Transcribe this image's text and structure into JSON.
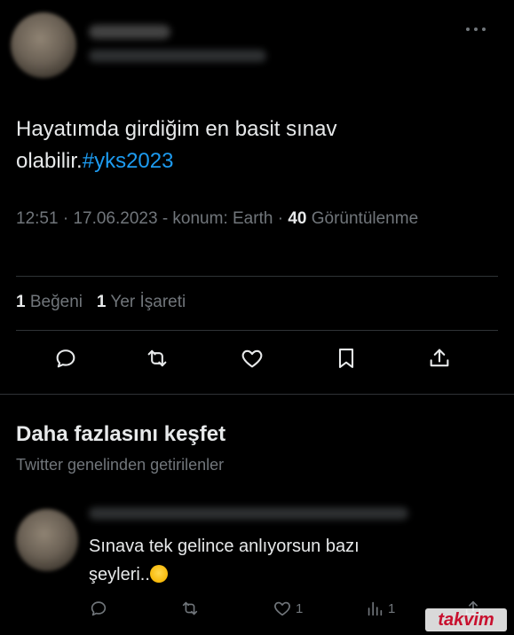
{
  "tweet": {
    "text_line1": "Hayatımda girdiğim en basit sınav",
    "text_line2_prefix": "olabilir.",
    "hashtag": "#yks2023",
    "meta": {
      "time": "12:51",
      "date": "17.06.2023",
      "location": "konum: Earth",
      "views_count": "40",
      "views_label": "Görüntülenme"
    },
    "stats": {
      "likes_count": "1",
      "likes_label": "Beğeni",
      "bookmarks_count": "1",
      "bookmarks_label": "Yer İşareti"
    },
    "actions": [
      "reply-icon",
      "retweet-icon",
      "heart-icon",
      "bookmark-icon",
      "share-icon"
    ]
  },
  "explore": {
    "title": "Daha fazlasını keşfet",
    "subtitle": "Twitter genelinden getirilenler"
  },
  "reply": {
    "line1": "Sınava tek gelince anlıyorsun bazı",
    "line2": "şeyleri..",
    "like_count": "1",
    "views_count": "1"
  },
  "watermark": {
    "text": "takvim"
  },
  "colors": {
    "background": "#000000",
    "text": "#e7e9ea",
    "secondary": "#71767b",
    "accent": "#1d9bf0",
    "divider": "#2f3336"
  }
}
